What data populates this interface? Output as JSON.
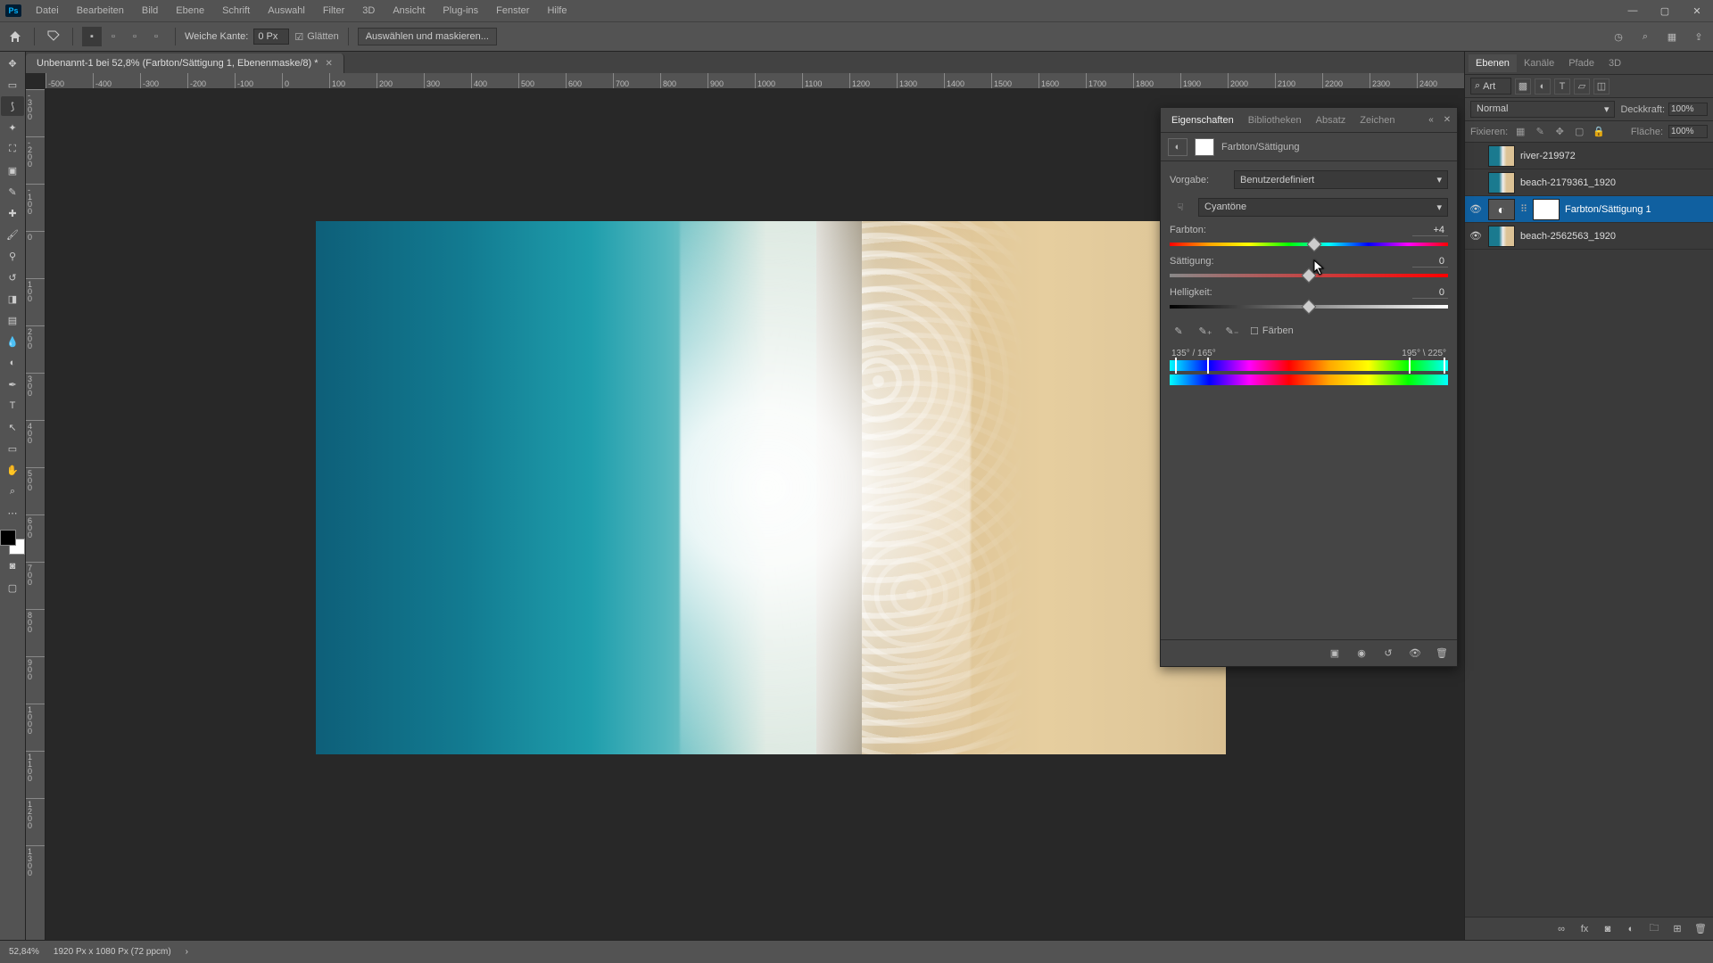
{
  "menu": {
    "items": [
      "Datei",
      "Bearbeiten",
      "Bild",
      "Ebene",
      "Schrift",
      "Auswahl",
      "Filter",
      "3D",
      "Ansicht",
      "Plug-ins",
      "Fenster",
      "Hilfe"
    ]
  },
  "optbar": {
    "feather_label": "Weiche Kante:",
    "feather_value": "0 Px",
    "antialias": "Glätten",
    "select_mask": "Auswählen und maskieren..."
  },
  "doc": {
    "tab_title": "Unbenannt-1 bei 52,8% (Farbton/Sättigung 1, Ebenenmaske/8) *",
    "h_ruler": [
      "-500",
      "-400",
      "-300",
      "-200",
      "-100",
      "0",
      "100",
      "200",
      "300",
      "400",
      "500",
      "600",
      "700",
      "800",
      "900",
      "1000",
      "1100",
      "1200",
      "1300",
      "1400",
      "1500",
      "1600",
      "1700",
      "1800",
      "1900",
      "2000",
      "2100",
      "2200",
      "2300",
      "2400"
    ],
    "v_ruler": [
      "-300",
      "-200",
      "-100",
      "0",
      "100",
      "200",
      "300",
      "400",
      "500",
      "600",
      "700",
      "800",
      "900",
      "1000",
      "1100",
      "1200",
      "1300"
    ]
  },
  "props": {
    "tabs": [
      "Eigenschaften",
      "Bibliotheken",
      "Absatz",
      "Zeichen"
    ],
    "title": "Farbton/Sättigung",
    "preset_label": "Vorgabe:",
    "preset_value": "Benutzerdefiniert",
    "channel_value": "Cyantöne",
    "hue_label": "Farbton:",
    "hue_value": "+4",
    "sat_label": "Sättigung:",
    "sat_value": "0",
    "light_label": "Helligkeit:",
    "light_value": "0",
    "colorize": "Färben",
    "range_left": "135° / 165°",
    "range_right": "195° \\ 225°"
  },
  "layers": {
    "tabs": [
      "Ebenen",
      "Kanäle",
      "Pfade",
      "3D"
    ],
    "search_kind": "Art",
    "blend": "Normal",
    "opacity_label": "Deckkraft:",
    "opacity_value": "100%",
    "lock_label": "Fixieren:",
    "fill_label": "Fläche:",
    "fill_value": "100%",
    "items": [
      {
        "name": "river-219972",
        "visible": false
      },
      {
        "name": "beach-2179361_1920",
        "visible": false
      },
      {
        "name": "Farbton/Sättigung 1",
        "visible": true,
        "adj": true,
        "selected": true
      },
      {
        "name": "beach-2562563_1920",
        "visible": true
      }
    ]
  },
  "status": {
    "zoom": "52,84%",
    "dims": "1920 Px x 1080 Px (72 ppcm)"
  }
}
